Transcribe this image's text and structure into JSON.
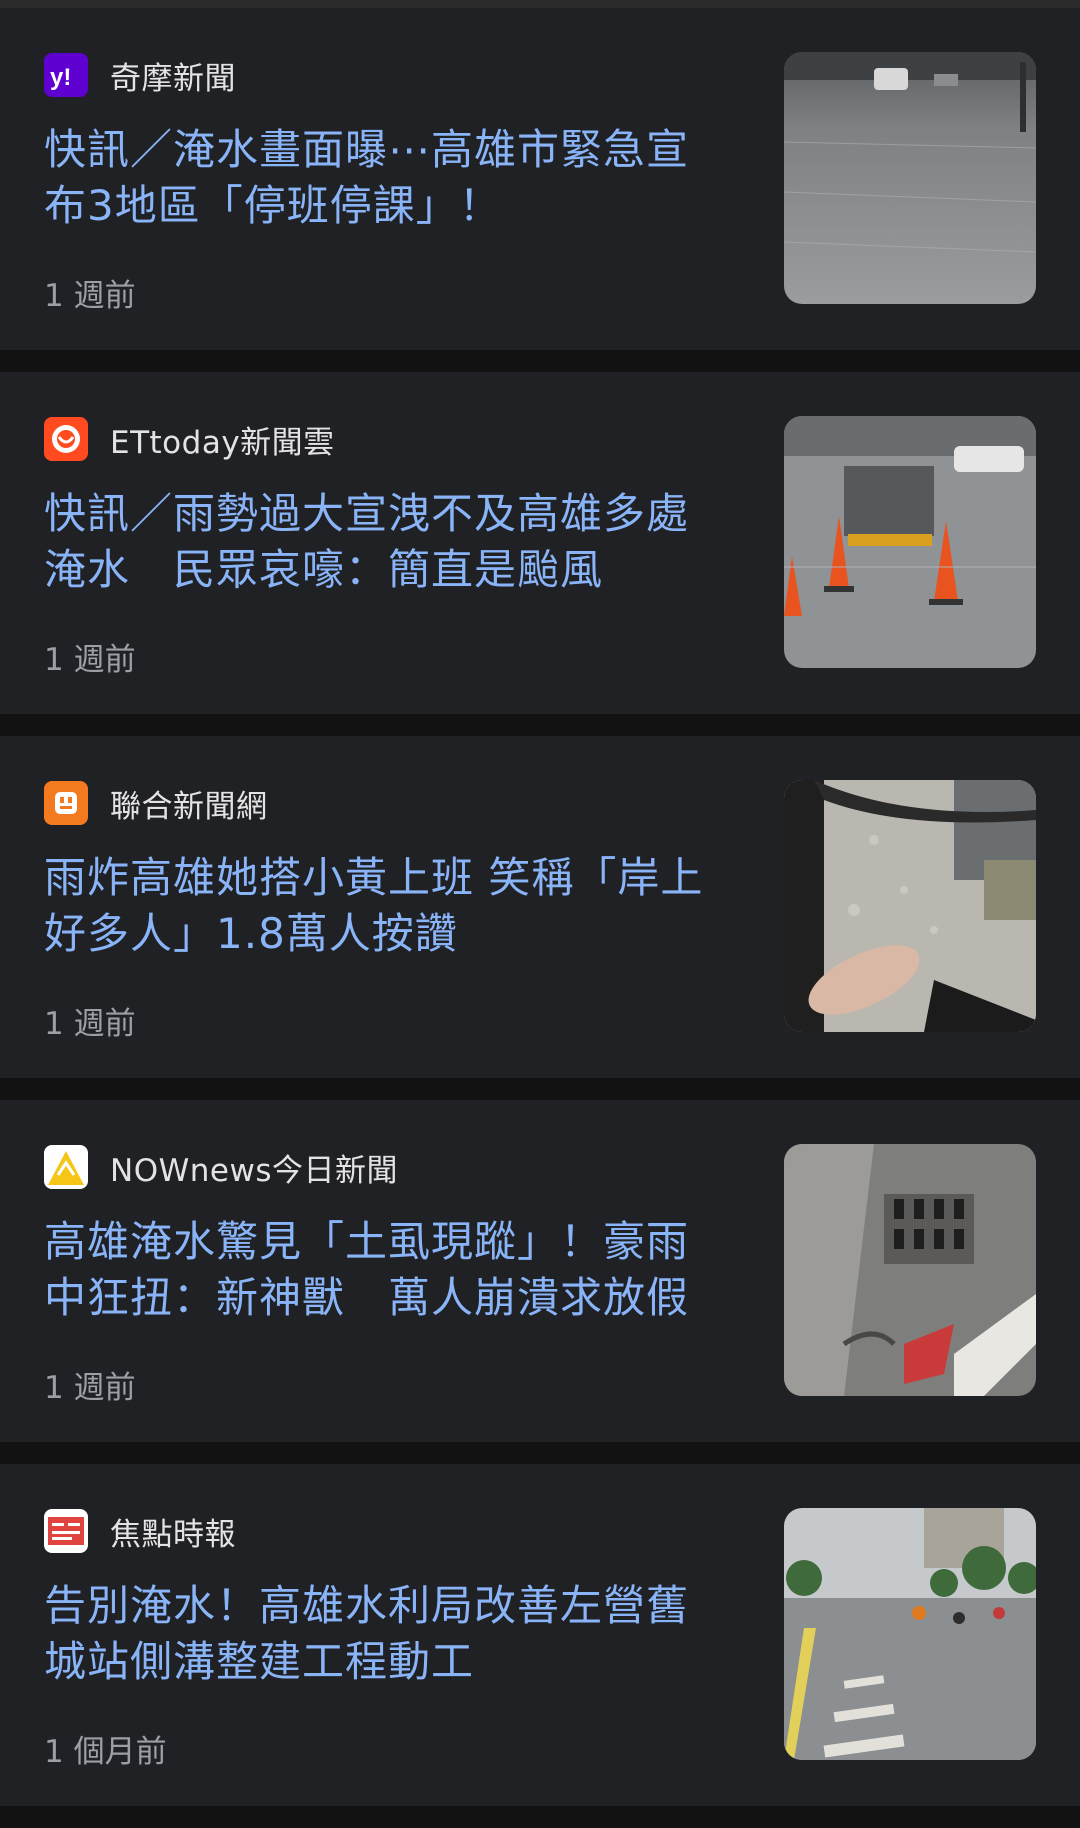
{
  "articles": [
    {
      "source": "奇摩新聞",
      "source_icon": "yahoo-icon",
      "brand_color": "#5f01d1",
      "title_line1": "快訊／淹水畫面曝⋯高雄市緊急宣",
      "title_line2": "布3地區「停班停課」！",
      "age": "1 週前",
      "thumbnail": "flooded-street-image"
    },
    {
      "source": "ETtoday新聞雲",
      "source_icon": "ettoday-icon",
      "brand_color": "#ff4b1f",
      "title_line1": "快訊／雨勢過大宣洩不及高雄多處",
      "title_line2": "淹水　民眾哀嚎：簡直是颱風",
      "age": "1 週前",
      "thumbnail": "traffic-cones-flood-image"
    },
    {
      "source": "聯合新聞網",
      "source_icon": "udn-icon",
      "brand_color": "#f47a1f",
      "title_line1": "雨炸高雄她搭小黃上班 笑稱「岸上",
      "title_line2": "好多人」1.8萬人按讚",
      "age": "1 週前",
      "thumbnail": "taxi-window-rain-image"
    },
    {
      "source": "NOWnews今日新聞",
      "source_icon": "nownews-icon",
      "brand_color": "#f5c518",
      "title_line1": "高雄淹水驚見「土虱現蹤」！豪雨",
      "title_line2": "中狂扭：新神獸　萬人崩潰求放假",
      "age": "1 週前",
      "thumbnail": "storm-drain-catfish-image"
    },
    {
      "source": "焦點時報",
      "source_icon": "focus-times-icon",
      "brand_color": "#e0443e",
      "title_line1": "告別淹水！高雄水利局改善左營舊",
      "title_line2": "城站側溝整建工程動工",
      "age": "1 個月前",
      "thumbnail": "rainy-road-scooters-image"
    }
  ]
}
